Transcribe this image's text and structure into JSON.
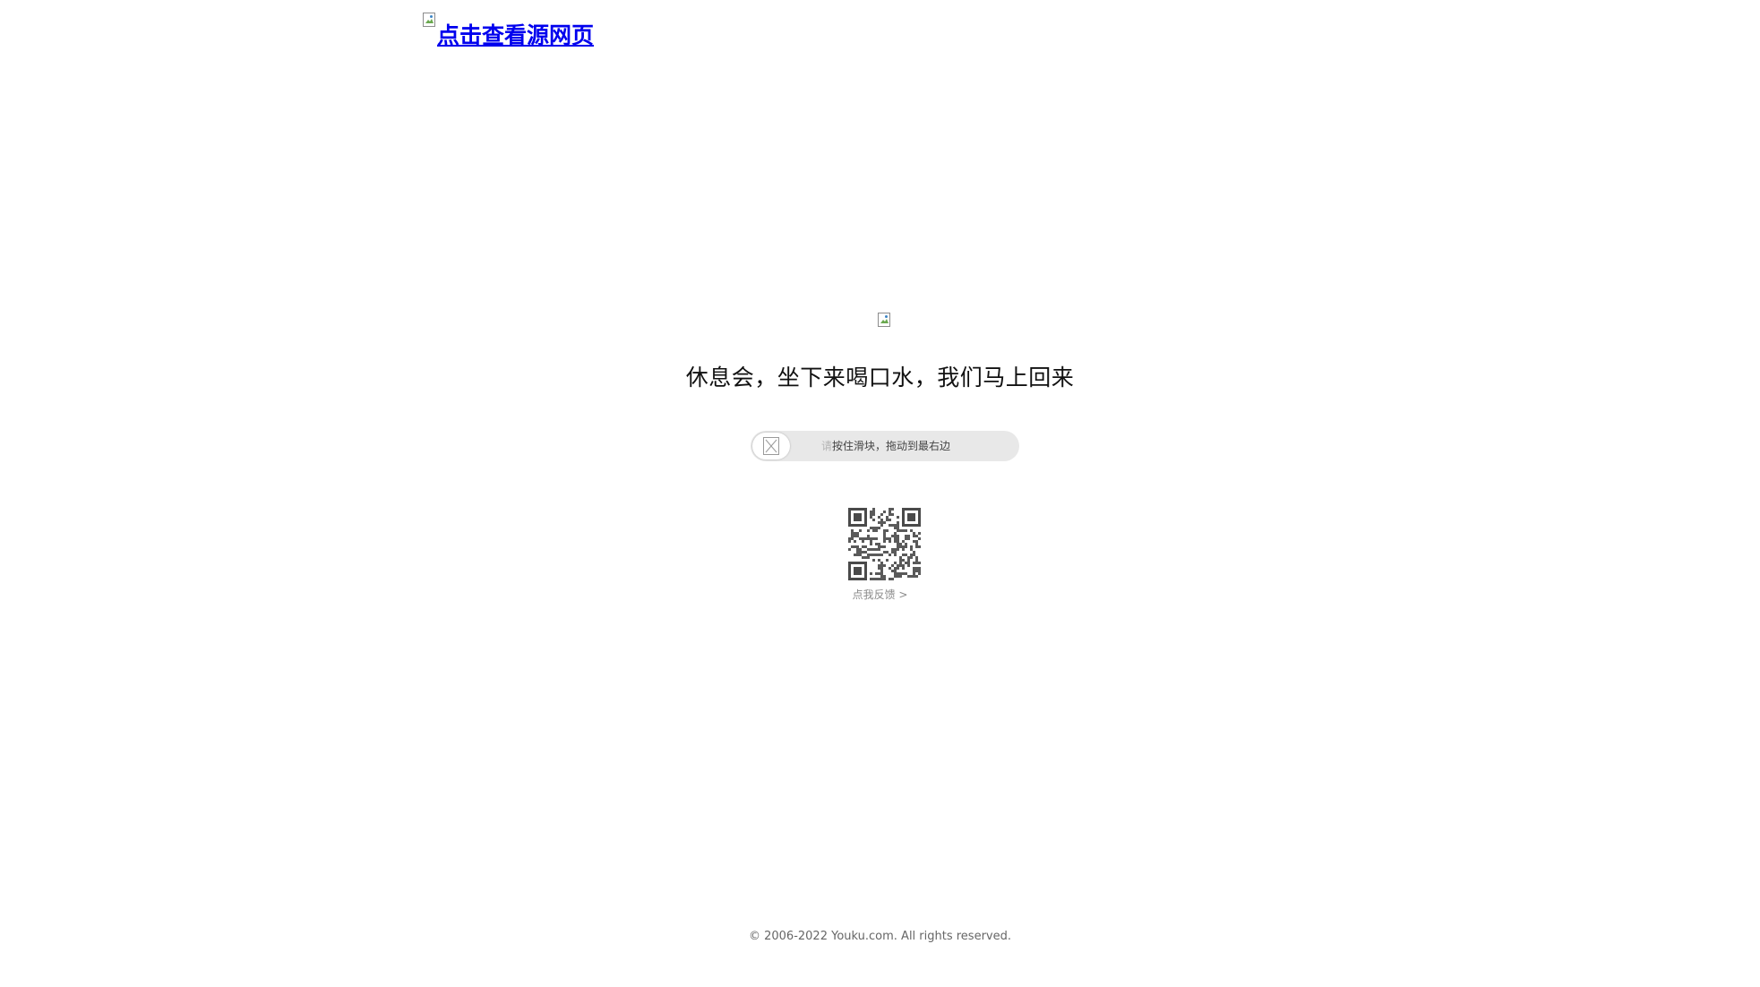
{
  "header": {
    "source_link_label": "点击查看源网页",
    "source_image_icon": "broken-image-icon"
  },
  "main": {
    "center_image_icon": "broken-image-icon",
    "headline": "休息会，坐下来喝口水，我们马上回来",
    "slider": {
      "handle_icon": "broken-image-icon",
      "hint_faded": "请",
      "hint": "按住滑块，拖动到最右边",
      "progress": 0
    },
    "qr_icon": "qr-code-icon",
    "feedback_label": "点我反馈 >"
  },
  "footer": {
    "copyright": "© 2006-2022 Youku.com. All rights reserved."
  },
  "colors": {
    "link": "#0000ee",
    "slider_track": "#e8e8e8",
    "text_dark": "#111111",
    "text_muted": "#8a8a8a"
  }
}
